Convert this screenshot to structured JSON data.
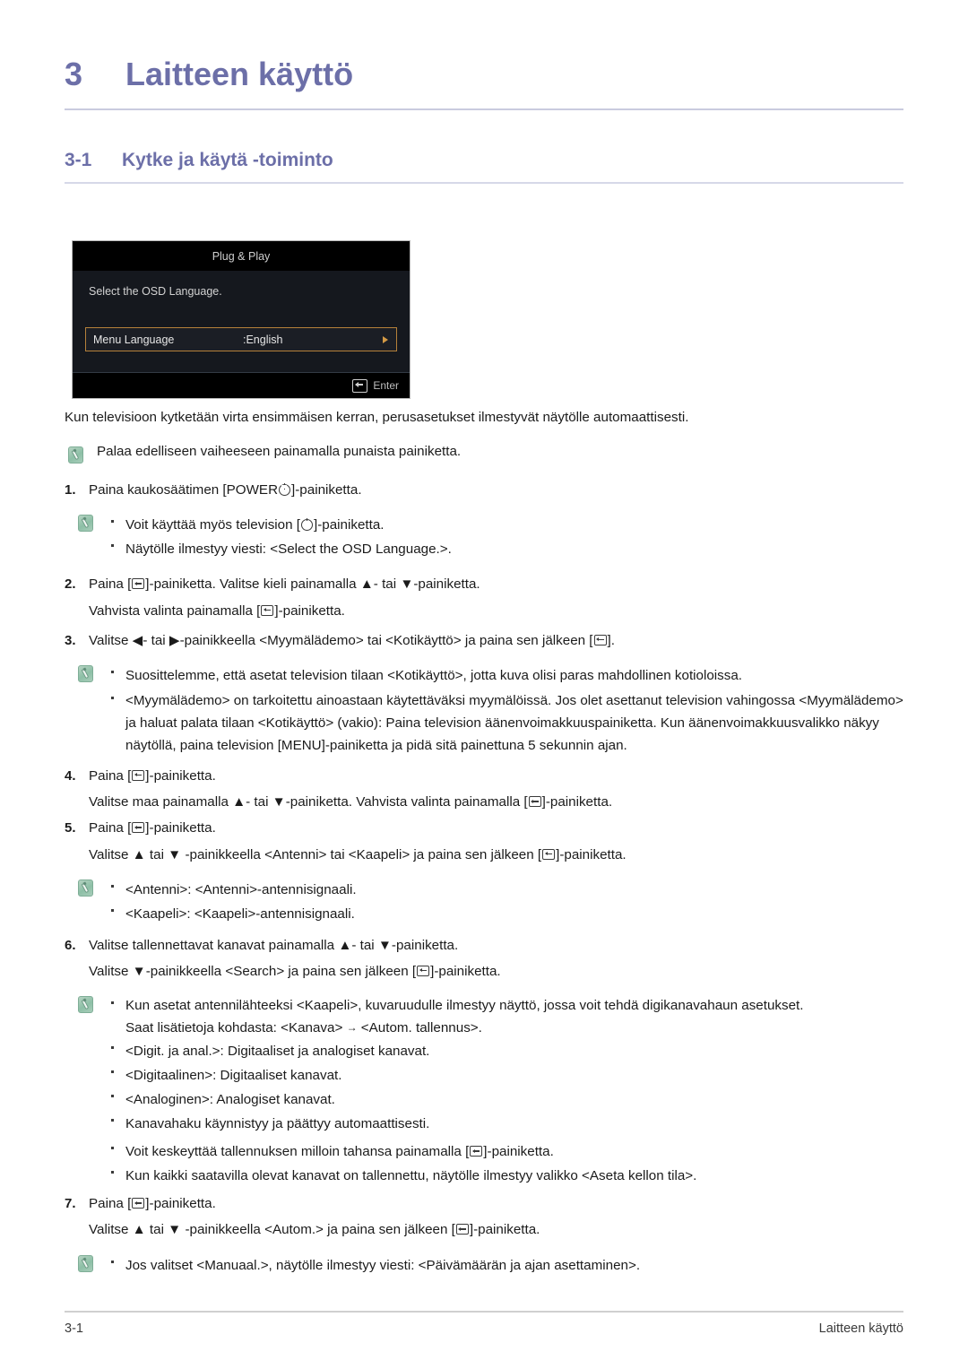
{
  "chapter": {
    "number": "3",
    "title": "Laitteen käyttö"
  },
  "section": {
    "number": "3-1",
    "title": "Kytke ja käytä -toiminto"
  },
  "osd": {
    "title": "Plug & Play",
    "subtitle": "Select the OSD Language.",
    "row_label": "Menu Language",
    "row_value": ":English",
    "enter_label": "Enter",
    "highlight_color": "#b5813a",
    "background_color": "#14161b"
  },
  "intro": "Kun televisioon kytketään virta ensimmäisen kerran, perusasetukset ilmestyvät näytölle automaattisesti.",
  "note_top": "Palaa edelliseen vaiheeseen painamalla punaista painiketta.",
  "steps": {
    "s1": {
      "num": "1.",
      "text_a": "Paina kaukosäätimen [POWER",
      "text_b": "]-painiketta.",
      "notes": {
        "b1_a": "Voit käyttää myös television [",
        "b1_b": "]-painiketta.",
        "b2": "Näytölle ilmestyy viesti: <Select the OSD Language.>."
      }
    },
    "s2": {
      "num": "2.",
      "line1_a": "Paina [",
      "line1_b": "]-painiketta. Valitse kieli painamalla ▲- tai ▼-painiketta.",
      "line2_a": "Vahvista valinta painamalla [",
      "line2_b": "]-painiketta."
    },
    "s3": {
      "num": "3.",
      "line1_a": "Valitse ◀- tai ▶-painikkeella <Myymälädemo> tai <Kotikäyttö> ja paina sen jälkeen [",
      "line1_b": "].",
      "notes": {
        "b1": "Suosittelemme, että asetat television tilaan <Kotikäyttö>, jotta kuva olisi paras mahdollinen kotioloissa.",
        "b2": "<Myymälädemo> on tarkoitettu ainoastaan käytettäväksi myymälöissä. Jos olet asettanut television vahingossa <Myymälädemo> ja haluat palata tilaan <Kotikäyttö> (vakio): Paina television äänenvoimakkuuspainiketta. Kun äänenvoimakkuusvalikko näkyy näytöllä, paina television [MENU]-painiketta ja pidä sitä painettuna 5 sekunnin ajan."
      }
    },
    "s4": {
      "num": "4.",
      "line1_a": "Paina [",
      "line1_b": "]-painiketta.",
      "line2_a": "Valitse maa painamalla ▲- tai ▼-painiketta. Vahvista valinta painamalla [",
      "line2_b": "]-painiketta."
    },
    "s5": {
      "num": "5.",
      "line1_a": "Paina [",
      "line1_b": "]-painiketta.",
      "line2_a": "Valitse ▲ tai ▼ -painikkeella <Antenni> tai <Kaapeli> ja paina sen jälkeen [",
      "line2_b": "]-painiketta.",
      "notes": {
        "b1": "<Antenni>: <Antenni>-antennisignaali.",
        "b2": "<Kaapeli>: <Kaapeli>-antennisignaali."
      }
    },
    "s6": {
      "num": "6.",
      "line1": "Valitse tallennettavat kanavat painamalla ▲- tai ▼-painiketta.",
      "line2_a": "Valitse ▼-painikkeella <Search> ja paina sen jälkeen [",
      "line2_b": "]-painiketta.",
      "notes": {
        "b1_line1": "Kun asetat antennilähteeksi <Kaapeli>, kuvaruudulle ilmestyy näyttö, jossa voit tehdä digikanavahaun asetukset.",
        "b1_line2_a": "Saat lisätietoja kohdasta: <Kanava>",
        "b1_line2_arrow": "→",
        "b1_line2_b": "<Autom. tallennus>.",
        "b2": "<Digit. ja anal.>: Digitaaliset ja analogiset kanavat.",
        "b3": "<Digitaalinen>: Digitaaliset kanavat.",
        "b4": "<Analoginen>: Analogiset kanavat.",
        "b5": "Kanavahaku käynnistyy ja päättyy automaattisesti.",
        "b6_a": "Voit keskeyttää tallennuksen milloin tahansa painamalla [",
        "b6_b": "]-painiketta.",
        "b7": "Kun kaikki saatavilla olevat kanavat on tallennettu, näytölle ilmestyy valikko <Aseta kellon tila>."
      }
    },
    "s7": {
      "num": "7.",
      "line1_a": "Paina [",
      "line1_b": "]-painiketta.",
      "line2_a": "Valitse ▲ tai ▼ -painikkeella <Autom.> ja paina sen jälkeen [",
      "line2_b": "]-painiketta.",
      "notes": {
        "b1": "Jos valitset <Manuaal.>, näytölle ilmestyy viesti: <Päivämäärän ja ajan asettaminen>."
      }
    }
  },
  "footer": {
    "left": "3-1",
    "right": "Laitteen käyttö"
  }
}
